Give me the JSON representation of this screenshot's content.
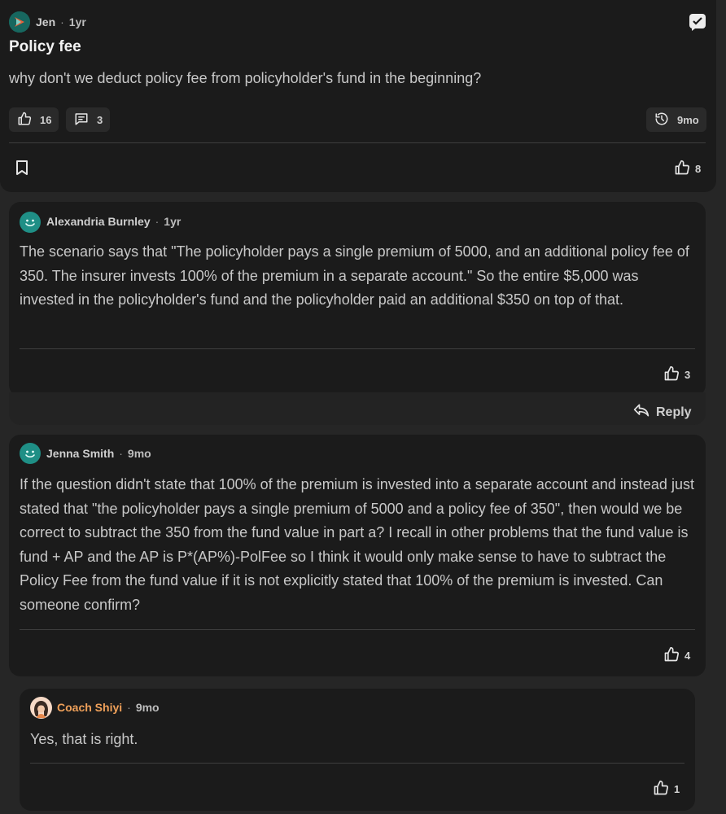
{
  "post": {
    "author": "Jen",
    "time": "1yr",
    "title": "Policy fee",
    "body": "why don't we deduct policy fee from policyholder's fund in the beginning?",
    "likes": "16",
    "comments": "3",
    "history": "9mo",
    "bookmark_likes": "8"
  },
  "comments": [
    {
      "author": "Alexandria Burnley",
      "time": "1yr",
      "body": "The scenario says that \"The policyholder pays a single premium of 5000, and an additional policy fee of 350. The insurer invests 100% of the premium in a separate account.\" So the entire $5,000 was invested in the policyholder's fund and the policyholder paid an additional $350 on top of that.",
      "likes": "3",
      "reply_label": "Reply"
    },
    {
      "author": "Jenna Smith",
      "time": "9mo",
      "body": "If the question didn't state that 100% of the premium is invested into a separate account and instead just stated that \"the policyholder pays a single premium of 5000 and a policy fee of 350\", then would we be correct to subtract the 350 from the fund value in part a? I recall in other problems that the fund value is fund + AP and the AP is P*(AP%)-PolFee so I think it would only make sense to have to subtract the Policy Fee from the fund value if it is not explicitly stated that 100% of the premium is invested. Can someone confirm?",
      "likes": "4"
    },
    {
      "author": "Coach Shiyi",
      "time": "9mo",
      "body": "Yes, that is right.",
      "likes": "1"
    }
  ],
  "colors": {
    "background": "#262626",
    "card": "#1b1b1b",
    "coach_name": "#f0a15a",
    "avatar_teal": "#1f8f86"
  }
}
